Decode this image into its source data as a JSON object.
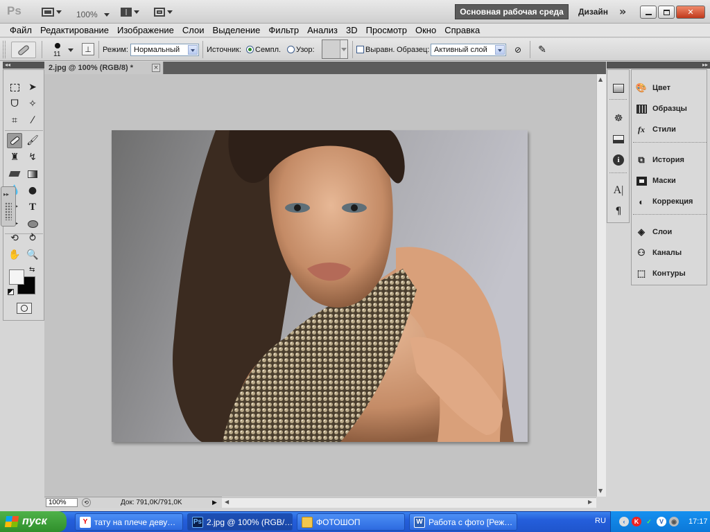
{
  "app": {
    "logo": "Ps",
    "zoom_display": "100%",
    "workspace_active": "Основная рабочая среда",
    "workspace_other": "Дизайн",
    "more": "»"
  },
  "menu": [
    "Файл",
    "Редактирование",
    "Изображение",
    "Слои",
    "Выделение",
    "Фильтр",
    "Анализ",
    "3D",
    "Просмотр",
    "Окно",
    "Справка"
  ],
  "options": {
    "brush_size": "11",
    "mode_label": "Режим:",
    "mode_value": "Нормальный",
    "source_label": "Источник:",
    "source_sampled": "Семпл.",
    "source_pattern": "Узор:",
    "aligned_label": "Выравн.",
    "sample_label": "Образец:",
    "sample_value": "Активный слой"
  },
  "document": {
    "tab_title": "2.jpg @ 100% (RGB/8) *",
    "close": "×",
    "zoom": "100%",
    "info": "Док: 791,0K/791,0K"
  },
  "panels": [
    {
      "label": "Цвет",
      "icon": "color-icon"
    },
    {
      "label": "Образцы",
      "icon": "swatches-icon"
    },
    {
      "label": "Стили",
      "icon": "styles-icon"
    },
    {
      "label": "История",
      "icon": "history-icon"
    },
    {
      "label": "Маски",
      "icon": "masks-icon"
    },
    {
      "label": "Коррекция",
      "icon": "adjustments-icon"
    },
    {
      "label": "Слои",
      "icon": "layers-icon"
    },
    {
      "label": "Каналы",
      "icon": "channels-icon"
    },
    {
      "label": "Контуры",
      "icon": "paths-icon"
    }
  ],
  "taskbar": {
    "start": "пуск",
    "tasks": [
      {
        "label": "тату на плече деву…",
        "icon": "Y"
      },
      {
        "label": "2.jpg @ 100% (RGB/…",
        "icon": "Ps"
      },
      {
        "label": "ФОТОШОП",
        "icon": "📁"
      },
      {
        "label": "Работа с фото [Реж…",
        "icon": "W"
      }
    ],
    "lang": "RU",
    "clock": "17:17"
  },
  "colors": {
    "workspace_active_bg": "#5b5b5b",
    "taskbar_blue": "#245edb",
    "start_green": "#3c9f38"
  }
}
